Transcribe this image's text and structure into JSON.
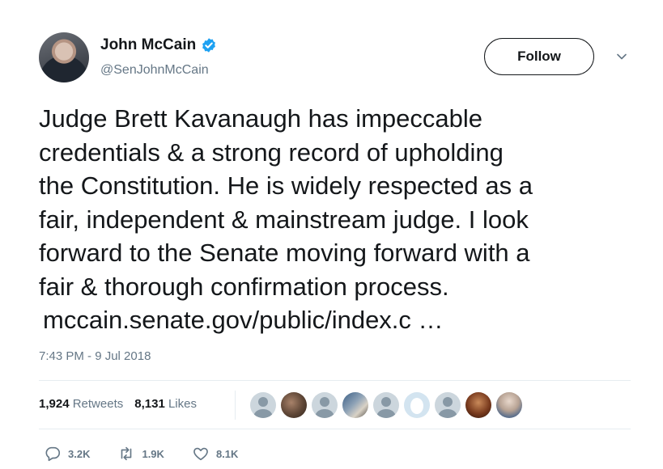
{
  "author": {
    "name": "John McCain",
    "handle": "@SenJohnMcCain",
    "verified": true
  },
  "follow_label": "Follow",
  "tweet": {
    "text": "Judge Brett Kavanaugh has impeccable\ncredentials & a strong record of upholding\nthe Constitution. He is widely respected as a\nfair, independent & mainstream judge. I look\nforward to the Senate moving forward with a\nfair & thorough confirmation process.",
    "link": "mccain.senate.gov/public/index.c  …",
    "timestamp": "7:43 PM - 9 Jul 2018"
  },
  "stats": {
    "retweets_count": "1,924",
    "retweets_label": "Retweets",
    "likes_count": "8,131",
    "likes_label": "Likes"
  },
  "actions": {
    "reply_count": "3.2K",
    "retweet_count": "1.9K",
    "like_count": "8.1K"
  },
  "colors": {
    "text": "#14171a",
    "muted": "#657786",
    "verified": "#1da1f2",
    "divider": "#e6ecf0"
  }
}
